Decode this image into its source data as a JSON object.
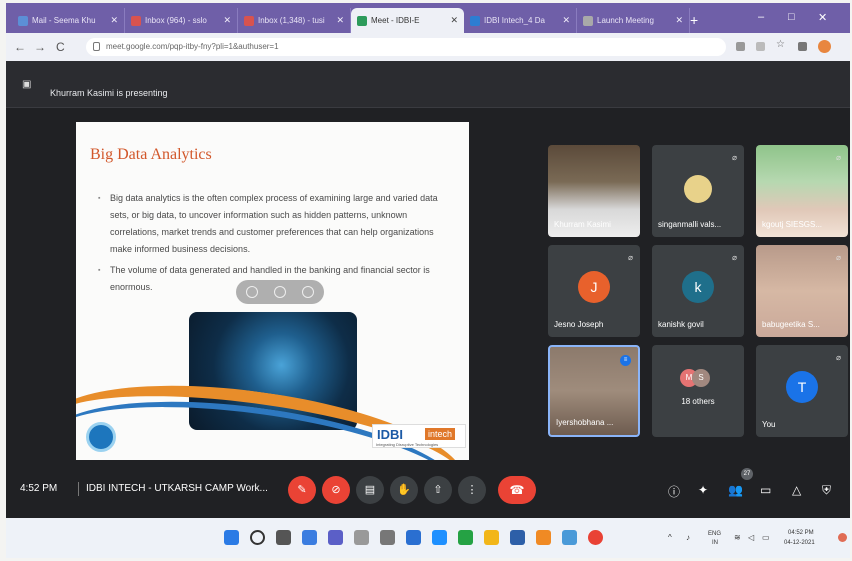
{
  "browser": {
    "tabs": [
      {
        "title": "Mail - Seema Khu",
        "color": "#5c8fd6"
      },
      {
        "title": "Inbox (964) - sslo",
        "color": "#d8534f"
      },
      {
        "title": "Inbox (1,348) - tusi",
        "color": "#d8534f"
      },
      {
        "title": "Meet - IDBI-E",
        "color": "#2d9b5b",
        "active": true
      },
      {
        "title": "IDBI Intech_4 Da",
        "color": "#2d7dd2"
      },
      {
        "title": "Launch Meeting",
        "color": "#a9a9a9"
      }
    ],
    "new_tab": "+",
    "window": {
      "minimize": "–",
      "maximize": "□",
      "close": "✕"
    },
    "nav": {
      "back": "←",
      "forward": "→",
      "reload": "C"
    },
    "url": "meet.google.com/pqp-itby-fny?pli=1&authuser=1"
  },
  "meet": {
    "presenting_banner": "Khurram Kasimi is presenting",
    "slide": {
      "title": "Big Data Analytics",
      "bullets": [
        "Big data analytics is the often complex process of examining large and varied data sets, or big data, to uncover information such as hidden patterns, unknown correlations, market trends and customer preferences that can help organizations make informed business decisions.",
        "The volume of data generated and handled in the banking and financial sector is enormous."
      ],
      "logo_text": "IDBI",
      "logo_suffix": "intech",
      "logo_tagline": "Integrating Disruptive Technologies"
    },
    "participants": [
      {
        "name": "Khurram Kasimi",
        "type": "video",
        "muted": false
      },
      {
        "name": "singanmalli vals...",
        "type": "avatar-photo",
        "muted": true
      },
      {
        "name": "kgoutj SIESGS...",
        "type": "video",
        "muted": true
      },
      {
        "name": "Jesno Joseph",
        "type": "avatar",
        "initial": "J",
        "color": "#e8612c",
        "muted": true
      },
      {
        "name": "kanishk govil",
        "type": "avatar",
        "initial": "k",
        "color": "#1f6f8b",
        "muted": true
      },
      {
        "name": "babugeetika S...",
        "type": "video",
        "muted": true
      },
      {
        "name": "Iyershobhana ...",
        "type": "video",
        "speaking": true
      },
      {
        "name": "18 others",
        "type": "others",
        "initials": [
          "M",
          "S"
        ],
        "muted": false
      },
      {
        "name": "You",
        "type": "avatar",
        "initial": "T",
        "color": "#1a73e8",
        "muted": true
      }
    ],
    "controls": {
      "time": "4:52 PM",
      "meeting_title": "IDBI INTECH - UTKARSH CAMP Work...",
      "people_count": "27"
    }
  },
  "taskbar": {
    "lang": "ENG",
    "region": "IN",
    "time": "04:52 PM",
    "date": "04-12-2021"
  }
}
